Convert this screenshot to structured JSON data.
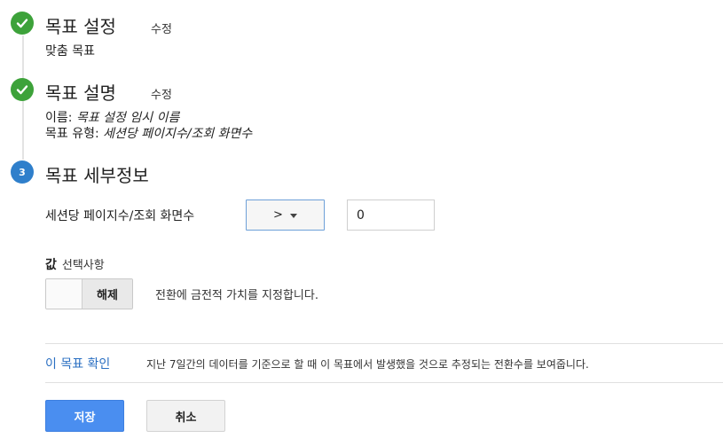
{
  "steps": [
    {
      "status": "done",
      "icon": "checkmark-icon",
      "title": "목표 설정",
      "edit_label": "수정",
      "summary": "맞춤 목표"
    },
    {
      "status": "done",
      "icon": "checkmark-icon",
      "title": "목표 설명",
      "edit_label": "수정",
      "summary_lines": [
        {
          "label": "이름: ",
          "value": "목표 설정 임시 이름"
        },
        {
          "label": "목표 유형: ",
          "value": "세션당 페이지수/조회 화면수"
        }
      ]
    },
    {
      "status": "current",
      "number": "3",
      "title": "목표 세부정보"
    }
  ],
  "details": {
    "field_label": "세션당 페이지수/조회 화면수",
    "comparison_operator": ">",
    "threshold_value": "0"
  },
  "value_section": {
    "heading": "값",
    "optional_label": "선택사항",
    "toggle_label": "해제",
    "toggle_state": "off",
    "description": "전환에 금전적 가치를 지정합니다."
  },
  "verify": {
    "link_label": "이 목표 확인",
    "description": "지난 7일간의 데이터를 기준으로 할 때 이 목표에서 발생했을 것으로 추정되는 전환수를 보여줍니다."
  },
  "actions": {
    "save_label": "저장",
    "cancel_label": "취소"
  },
  "colors": {
    "done": "#3da23a",
    "current": "#2f7fcb",
    "primary_button": "#4a8ef0",
    "link": "#2a6fc2"
  }
}
